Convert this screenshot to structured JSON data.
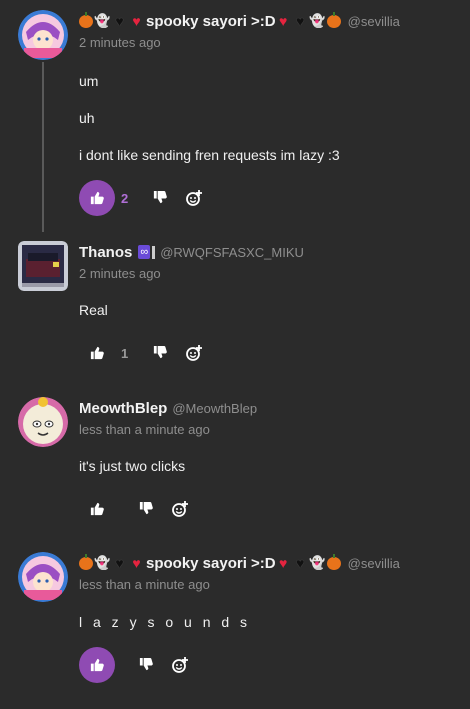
{
  "comments": [
    {
      "author": "spooky sayori >:D",
      "handle": "@sevillia",
      "time": "2 minutes ago",
      "lines": [
        "um",
        "uh",
        "i dont like sending fren requests im lazy :3"
      ],
      "likes": "2",
      "liked": true
    },
    {
      "author": "Thanos",
      "badge": "∞",
      "handle": "@RWQFSFASXC_MIKU",
      "time": "2 minutes ago",
      "lines": [
        "Real"
      ],
      "likes": "1",
      "liked": false
    },
    {
      "author": "MeowthBlep",
      "handle": "@MeowthBlep",
      "time": "less than a minute ago",
      "lines": [
        "it's just two clicks"
      ],
      "likes": "",
      "liked": false
    },
    {
      "author": "spooky sayori >:D",
      "handle": "@sevillia",
      "time": "less than a minute ago",
      "lines": [
        "l a z y   s o u n d s"
      ],
      "likes": "",
      "liked": true
    }
  ],
  "icons": {
    "like": "thumbs-up-icon",
    "dislike": "thumbs-down-icon",
    "react": "add-reaction-icon"
  },
  "colors": {
    "background": "#2b2b2b",
    "accent_purple": "#8f4bb3",
    "muted_text": "#8e8e8e"
  }
}
